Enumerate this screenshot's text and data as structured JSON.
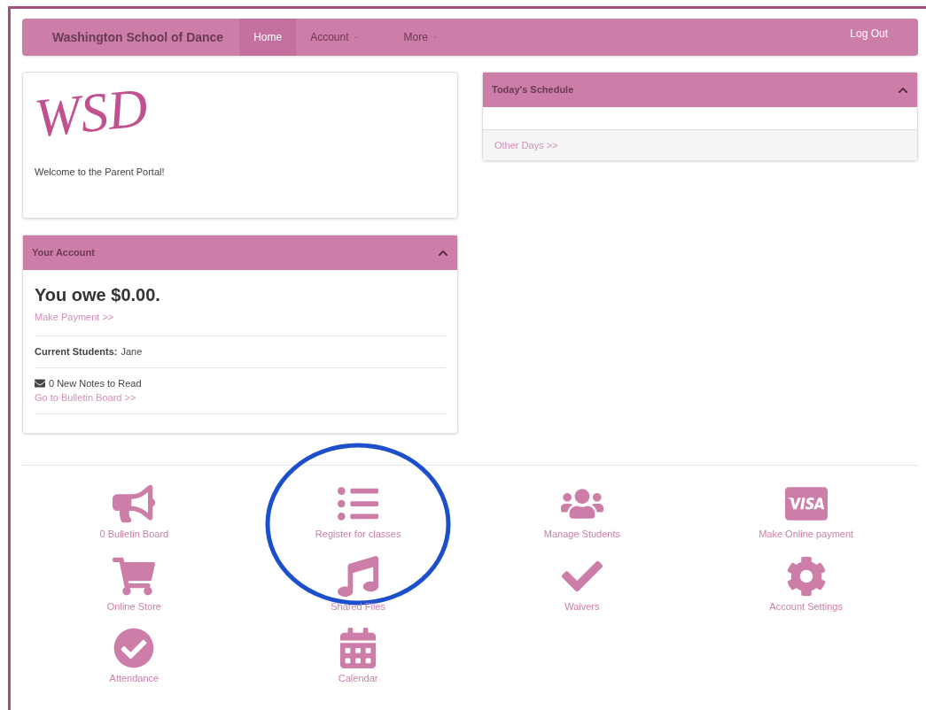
{
  "navbar": {
    "brand": "Washington School of Dance",
    "items": [
      {
        "label": "Home",
        "selected": true,
        "dropdown": false
      },
      {
        "label": "Account",
        "selected": false,
        "dropdown": true
      },
      {
        "label": "More",
        "selected": false,
        "dropdown": true
      }
    ],
    "logout": "Log Out"
  },
  "welcome": {
    "logo_text": "WSD",
    "message": "Welcome to the Parent Portal!"
  },
  "account": {
    "title": "Your Account",
    "expanded": true,
    "balance": "You owe $0.00.",
    "payment_link": "Make Payment >>",
    "students_label": "Current Students:",
    "students": "Jane",
    "notes": "0 New Notes to Read",
    "bulletin_link": "Go to Bulletin Board >>"
  },
  "schedule": {
    "title": "Today's Schedule",
    "expanded": true,
    "footer_link": "Other Days >>"
  },
  "tiles": [
    {
      "label": "0 Bulletin Board",
      "circled": false
    },
    {
      "label": "Register for classes",
      "circled": true
    },
    {
      "label": "Manage Students",
      "circled": false
    },
    {
      "label": "Make Online payment",
      "circled": false
    },
    {
      "label": "Online Store",
      "circled": false
    },
    {
      "label": "Shared Files",
      "circled": false
    },
    {
      "label": "Waivers",
      "circled": false
    },
    {
      "label": "Account Settings",
      "circled": false
    },
    {
      "label": "Attendance",
      "circled": false
    },
    {
      "label": "Calendar",
      "circled": false
    }
  ]
}
